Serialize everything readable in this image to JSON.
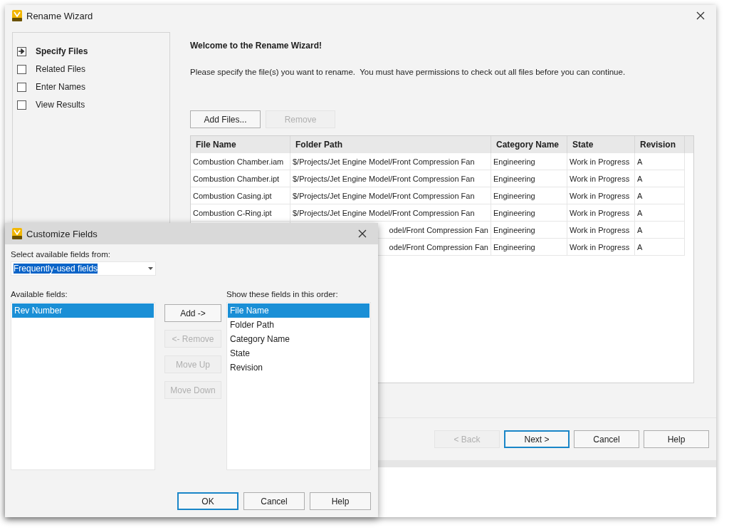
{
  "wizard": {
    "title": "Rename Wizard",
    "steps": [
      {
        "label": "Specify Files",
        "selected": true
      },
      {
        "label": "Related Files",
        "selected": false
      },
      {
        "label": "Enter Names",
        "selected": false
      },
      {
        "label": "View Results",
        "selected": false
      }
    ],
    "heading": "Welcome to the Rename Wizard!",
    "instructions": "Please specify the file(s) you want to rename.  You must have permissions to check out all files before you can continue.",
    "file_buttons": [
      {
        "label": "Add Files...",
        "disabled": false
      },
      {
        "label": "Remove",
        "disabled": true
      }
    ],
    "table": {
      "columns": [
        "File Name",
        "Folder Path",
        "Category Name",
        "State",
        "Revision"
      ],
      "rows": [
        {
          "file_name": "Combustion Chamber.iam",
          "folder_path": "$/Projects/Jet Engine Model/Front Compression Fan",
          "category_name": "Engineering",
          "state": "Work in Progress",
          "revision": "A"
        },
        {
          "file_name": "Combustion Chamber.ipt",
          "folder_path": "$/Projects/Jet Engine Model/Front Compression Fan",
          "category_name": "Engineering",
          "state": "Work in Progress",
          "revision": "A"
        },
        {
          "file_name": "Combustion Casing.ipt",
          "folder_path": "$/Projects/Jet Engine Model/Front Compression Fan",
          "category_name": "Engineering",
          "state": "Work in Progress",
          "revision": "A"
        },
        {
          "file_name": "Combustion C-Ring.ipt",
          "folder_path": "$/Projects/Jet Engine Model/Front Compression Fan",
          "category_name": "Engineering",
          "state": "Work in Progress",
          "revision": "A"
        },
        {
          "folder_path": "odel/Front Compression Fan",
          "category_name": "Engineering",
          "state": "Work in Progress",
          "revision": "A"
        },
        {
          "folder_path": "odel/Front Compression Fan",
          "category_name": "Engineering",
          "state": "Work in Progress",
          "revision": "A"
        }
      ]
    },
    "buttons": [
      {
        "label": "< Back",
        "disabled": true,
        "default": false
      },
      {
        "label": "Next >",
        "disabled": false,
        "default": true
      },
      {
        "label": "Cancel",
        "disabled": false,
        "default": false
      },
      {
        "label": "Help",
        "disabled": false,
        "default": false
      }
    ]
  },
  "dialog": {
    "title": "Customize Fields",
    "source_label": "Select available fields from:",
    "source_combo": {
      "value": "Frequently-used fields",
      "highlighted": true
    },
    "available_label": "Available fields:",
    "available_fields": [
      {
        "label": "Rev Number",
        "selected": true
      }
    ],
    "middle_buttons": [
      {
        "label": "Add ->",
        "disabled": false
      },
      {
        "label": "<- Remove",
        "disabled": true
      },
      {
        "label": "Move Up",
        "disabled": true
      },
      {
        "label": "Move Down",
        "disabled": true
      }
    ],
    "shown_label": "Show these fields in this order:",
    "shown_fields": [
      {
        "label": "File Name",
        "selected": true
      },
      {
        "label": "Folder Path",
        "selected": false
      },
      {
        "label": "Category Name",
        "selected": false
      },
      {
        "label": "State",
        "selected": false
      },
      {
        "label": "Revision",
        "selected": false
      }
    ],
    "buttons": [
      {
        "label": "OK",
        "disabled": false,
        "default": true
      },
      {
        "label": "Cancel",
        "disabled": false,
        "default": false
      },
      {
        "label": "Help",
        "disabled": false,
        "default": false
      }
    ]
  }
}
